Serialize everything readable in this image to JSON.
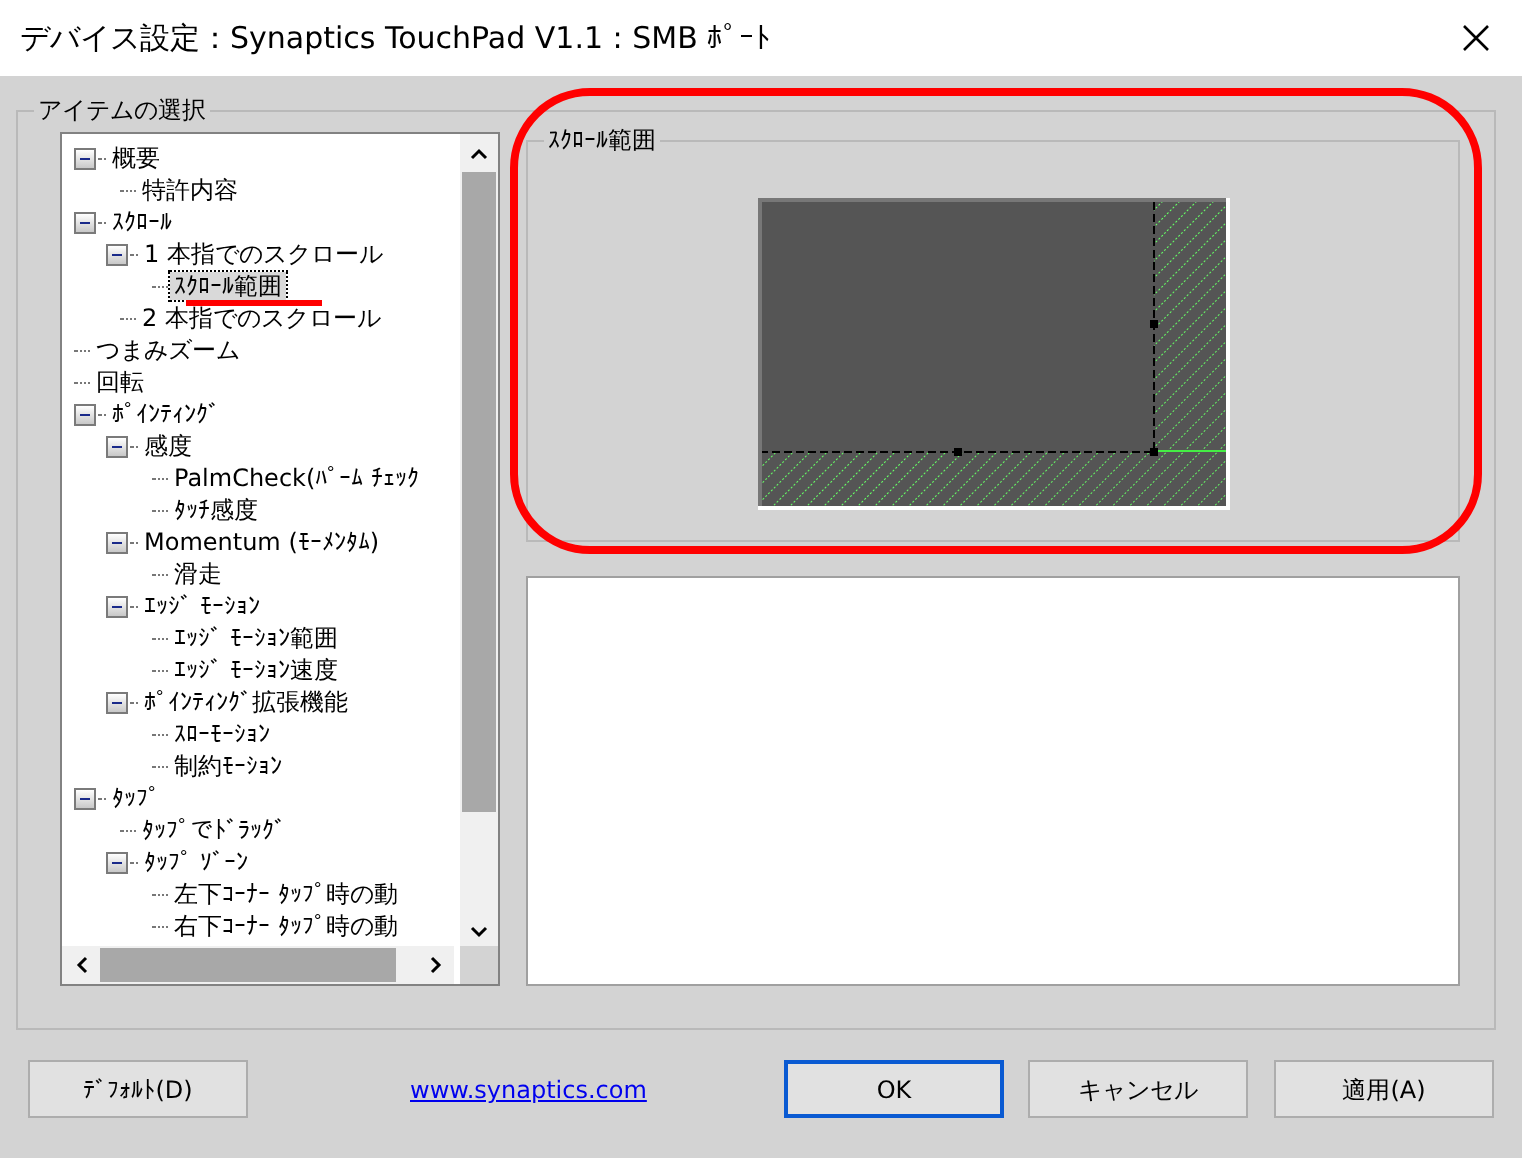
{
  "window": {
    "title": "デバイス設定：Synaptics TouchPad V1.1 : SMB ﾎﾟｰﾄ"
  },
  "item_group": {
    "title": "アイテムの選択"
  },
  "tree": {
    "items": [
      {
        "label": "概要",
        "expanded": true,
        "selected": false,
        "children": [
          {
            "label": "特許内容",
            "selected": false
          }
        ]
      },
      {
        "label": "ｽｸﾛｰﾙ",
        "expanded": true,
        "selected": false,
        "children": [
          {
            "label": "1 本指でのスクロール",
            "expanded": true,
            "selected": false,
            "children": [
              {
                "label": "ｽｸﾛｰﾙ範囲",
                "selected": true
              }
            ]
          },
          {
            "label": "2 本指でのスクロール",
            "selected": false
          }
        ]
      },
      {
        "label": "つまみズーム",
        "selected": false
      },
      {
        "label": "回転",
        "selected": false
      },
      {
        "label": "ﾎﾟｲﾝﾃｨﾝｸﾞ",
        "expanded": true,
        "selected": false,
        "children": [
          {
            "label": "感度",
            "expanded": true,
            "selected": false,
            "children": [
              {
                "label": "PalmCheck(ﾊﾟｰﾑ ﾁｪｯｸ",
                "selected": false
              },
              {
                "label": "ﾀｯﾁ感度",
                "selected": false
              }
            ]
          },
          {
            "label": "Momentum (ﾓｰﾒﾝﾀﾑ)",
            "expanded": true,
            "selected": false,
            "children": [
              {
                "label": "滑走",
                "selected": false
              }
            ]
          },
          {
            "label": "ｴｯｼﾞ ﾓｰｼｮﾝ",
            "expanded": true,
            "selected": false,
            "children": [
              {
                "label": "ｴｯｼﾞ ﾓｰｼｮﾝ範囲",
                "selected": false
              },
              {
                "label": "ｴｯｼﾞ ﾓｰｼｮﾝ速度",
                "selected": false
              }
            ]
          },
          {
            "label": "ﾎﾟｲﾝﾃｨﾝｸﾞ拡張機能",
            "expanded": true,
            "selected": false,
            "children": [
              {
                "label": "ｽﾛｰﾓｰｼｮﾝ",
                "selected": false
              },
              {
                "label": "制約ﾓｰｼｮﾝ",
                "selected": false
              }
            ]
          }
        ]
      },
      {
        "label": "ﾀｯﾌﾟ",
        "expanded": true,
        "selected": false,
        "children": [
          {
            "label": "ﾀｯﾌﾟでﾄﾞﾗｯｸﾞ",
            "selected": false
          },
          {
            "label": "ﾀｯﾌﾟ ｿﾞｰﾝ",
            "expanded": true,
            "selected": false,
            "children": [
              {
                "label": "左下ｺｰﾅｰ ﾀｯﾌﾟ時の動",
                "selected": false
              },
              {
                "label": "右下ｺｰﾅｰ ﾀｯﾌﾟ時の動",
                "selected": false
              }
            ]
          }
        ]
      }
    ]
  },
  "settings_group": {
    "title": "ｽｸﾛｰﾙ範囲"
  },
  "annotations": {
    "ring": true,
    "underline": true
  },
  "footer": {
    "default_button": "ﾃﾞﾌｫﾙﾄ(D)",
    "link": "www.synaptics.com",
    "buttons": [
      {
        "label": "OK",
        "focused": true
      },
      {
        "label": "キャンセル",
        "focused": false
      },
      {
        "label": "適用(A)",
        "focused": false
      }
    ]
  }
}
